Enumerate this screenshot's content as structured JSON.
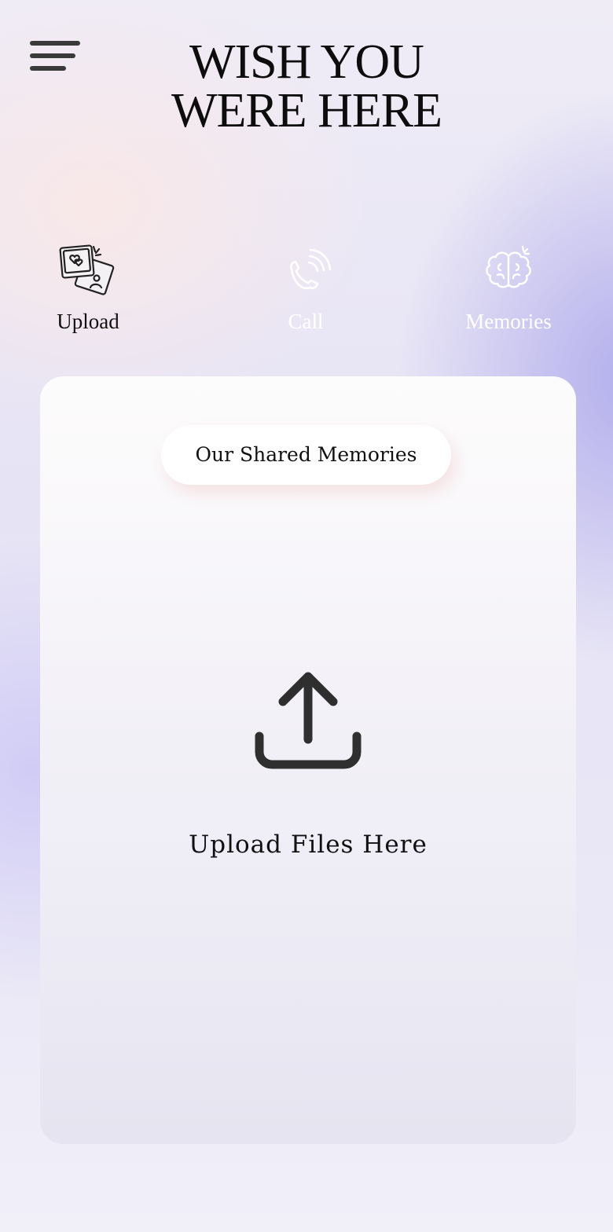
{
  "header": {
    "menu_icon": "hamburger-menu-icon",
    "title_line1": "WISH YOU",
    "title_line2": "WERE HERE"
  },
  "tabs": [
    {
      "label": "Upload",
      "icon": "photos-icon",
      "active": true,
      "color": "#111111"
    },
    {
      "label": "Call",
      "icon": "phone-call-icon",
      "active": false,
      "color": "#ffffff"
    },
    {
      "label": "Memories",
      "icon": "brain-icon",
      "active": false,
      "color": "#ffffff"
    }
  ],
  "card": {
    "section_title": "Our Shared Memories",
    "upload_icon": "upload-icon",
    "upload_label": "Upload Files Here"
  },
  "colors": {
    "accent_lavender": "#aaa5eb",
    "icon_dark": "#2f2f2f"
  }
}
